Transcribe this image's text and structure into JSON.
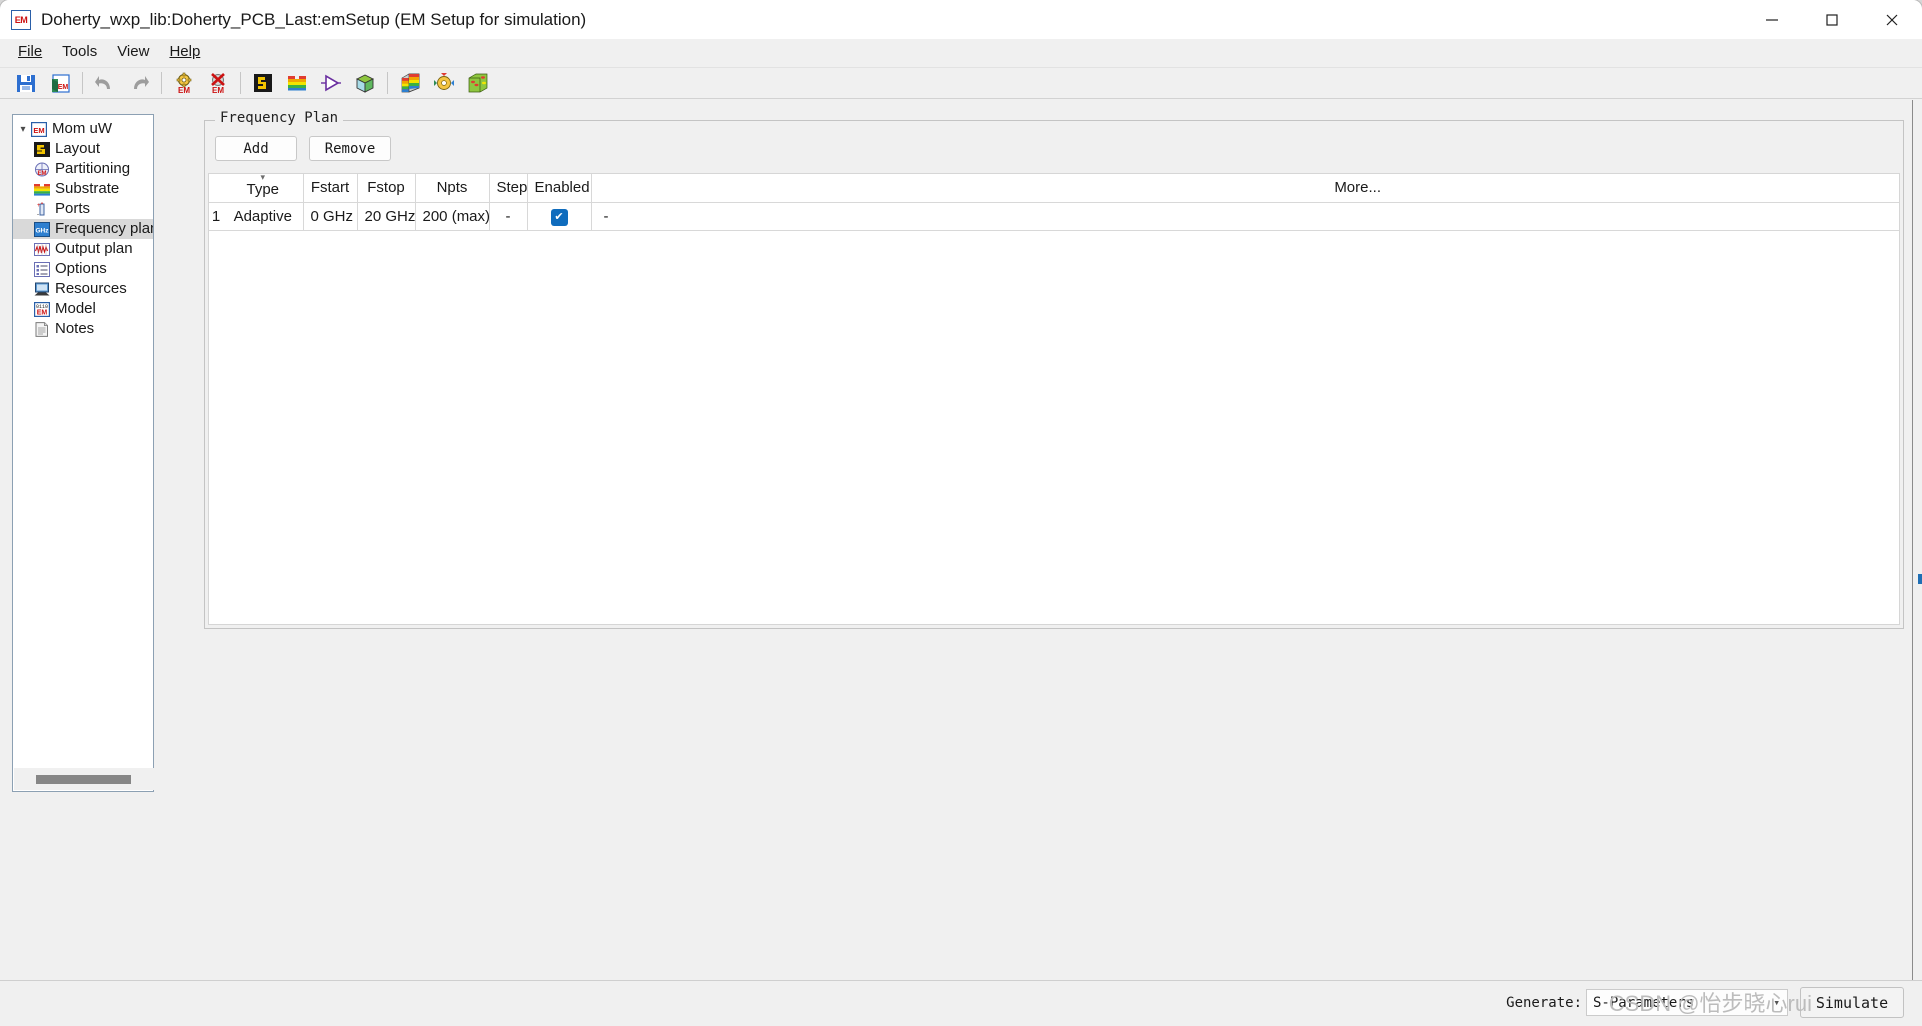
{
  "window": {
    "icon_text": "EM",
    "title": "Doherty_wxp_lib:Doherty_PCB_Last:emSetup (EM Setup for simulation)",
    "controls": {
      "minimize": "—",
      "maximize": "☐",
      "close": "✕"
    }
  },
  "menubar": {
    "items": [
      {
        "label": "File",
        "accel": "F"
      },
      {
        "label": "Tools",
        "accel": "T"
      },
      {
        "label": "View",
        "accel": "V"
      },
      {
        "label": "Help",
        "accel": "H"
      }
    ]
  },
  "toolbar": {
    "items": [
      {
        "name": "save-icon",
        "tooltip": "Save"
      },
      {
        "name": "save-em-setup-icon",
        "tooltip": "Save EM Setup"
      },
      {
        "name": "undo-icon",
        "tooltip": "Undo"
      },
      {
        "name": "redo-icon",
        "tooltip": "Redo"
      },
      {
        "name": "em-simulate-icon",
        "tooltip": "Simulate EM"
      },
      {
        "name": "em-stop-icon",
        "tooltip": "Stop EM simulation"
      },
      {
        "name": "layout-icon",
        "tooltip": "Layout"
      },
      {
        "name": "substrate-icon",
        "tooltip": "Substrate"
      },
      {
        "name": "schematic-symbol-icon",
        "tooltip": "Symbol"
      },
      {
        "name": "3d-view-icon",
        "tooltip": "3D View"
      },
      {
        "name": "3d-em-preview-icon",
        "tooltip": "3D EM Preview"
      },
      {
        "name": "em-cosimulation-icon",
        "tooltip": "EM Cosimulation"
      },
      {
        "name": "em-mesh-icon",
        "tooltip": "EM Mesh"
      }
    ]
  },
  "sidebar": {
    "root": {
      "label": "Mom uW",
      "icon": "em-icon",
      "expanded": true
    },
    "items": [
      {
        "label": "Layout",
        "icon": "layout-icon",
        "selected": false
      },
      {
        "label": "Partitioning",
        "icon": "partitioning-icon",
        "selected": false
      },
      {
        "label": "Substrate",
        "icon": "substrate-icon",
        "selected": false
      },
      {
        "label": "Ports",
        "icon": "ports-icon",
        "selected": false
      },
      {
        "label": "Frequency plan",
        "icon": "ghz-icon",
        "selected": true
      },
      {
        "label": "Output plan",
        "icon": "output-plan-icon",
        "selected": false
      },
      {
        "label": "Options",
        "icon": "options-icon",
        "selected": false
      },
      {
        "label": "Resources",
        "icon": "resources-icon",
        "selected": false
      },
      {
        "label": "Model",
        "icon": "model-icon",
        "selected": false
      },
      {
        "label": "Notes",
        "icon": "notes-icon",
        "selected": false
      }
    ]
  },
  "main": {
    "group_title": "Frequency Plan",
    "add_label": "Add",
    "remove_label": "Remove",
    "table": {
      "columns": [
        "",
        "Type",
        "Fstart",
        "Fstop",
        "Npts",
        "Step",
        "Enabled",
        "More..."
      ],
      "sort_indicator_column": "Type",
      "rows": [
        {
          "index": "1",
          "type": "Adaptive",
          "fstart": "0 GHz",
          "fstop": "20 GHz",
          "npts": "200 (max)",
          "step": "-",
          "enabled": true,
          "more": "-"
        }
      ]
    }
  },
  "bottom": {
    "generate_label": "Generate:",
    "generate_value": "S-Parameters",
    "simulate_label": "Simulate"
  },
  "watermark": "CSDN @怡步晓心rui",
  "colors": {
    "accent": "#0f6cbd",
    "titlebar": "#ffffff",
    "chrome": "#f0f0f0",
    "selection": "#d9d9d9",
    "edge_accent": "#1f6fb5"
  }
}
